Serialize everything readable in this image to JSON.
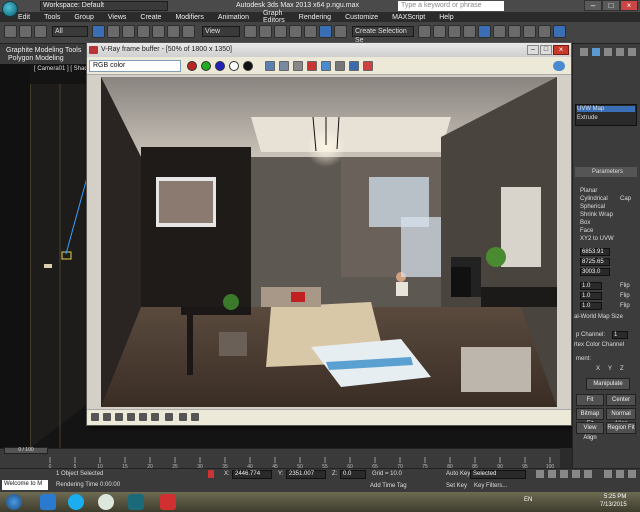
{
  "titlebar": {
    "workspace": "Workspace: Default",
    "window_title": "Autodesk 3ds Max  2013 x64     p.ngu.max",
    "search_placeholder": "Type a keyword or phrase"
  },
  "menu": [
    "Edit",
    "Tools",
    "Group",
    "Views",
    "Create",
    "Modifiers",
    "Animation",
    "Graph Editors",
    "Rendering",
    "Customize",
    "MAXScript",
    "Help"
  ],
  "toolbar": {
    "filter": "All",
    "ref_coord": "View",
    "selection_set": "Create Selection Se"
  },
  "graphite": {
    "title": "Graphite Modeling Tools",
    "subtitle": "Polygon Modeling"
  },
  "viewport": {
    "label": "[ Camera01 ] [ Shade"
  },
  "vfb": {
    "title": "V-Ray frame buffer - [50% of 1800 x 1350]",
    "channel": "RGB color"
  },
  "command_panel": {
    "modifier_list": [
      "UVW Map",
      "Extrude"
    ],
    "parameters_label": "Parameters",
    "mapping": [
      "Planar",
      "Cylindrical",
      "Cap",
      "Spherical",
      "Shrink Wrap",
      "Box",
      "Face",
      "XY2 to UVW"
    ],
    "length": "6853.91",
    "width": "8725.65",
    "height": "3003.0",
    "tile_u": "1.0",
    "tile_v": "1.0",
    "tile_w": "1.0",
    "flip": "Flip",
    "real_world": "al-World Map Size",
    "channel": "p Channel:",
    "channel_value": "1",
    "vertex_color": "rtex Color Channel",
    "alignment": "ment:",
    "axis": [
      "X",
      "Y",
      "Z"
    ],
    "manipulate": "Manipulate",
    "fit": "Fit",
    "center": "Center",
    "bitmap_fit": "Bitmap Fit",
    "normal_align": "Normal Align",
    "view_align": "View Align",
    "region_fit": "Region Fit"
  },
  "timeline": {
    "frame_slider": "0 / 100",
    "ticks": [
      "0",
      "5",
      "10",
      "15",
      "20",
      "25",
      "30",
      "35",
      "40",
      "45",
      "50",
      "55",
      "60",
      "65",
      "70",
      "75",
      "80",
      "85",
      "90",
      "95",
      "100"
    ]
  },
  "status": {
    "maxscript": "Welcome to M",
    "selected": "1 Object Selected",
    "render_time": "Rendering Time  0:00:00",
    "x_label": "X:",
    "x_value": "2446.774",
    "y_label": "Y:",
    "y_value": "2351.007",
    "z_label": "Z:",
    "z_value": "0.0",
    "grid": "Grid = 10.0",
    "add_time_tag": "Add Time Tag",
    "auto_key": "Auto Key",
    "selected_dropdown": "Selected",
    "set_key": "Set Key",
    "key_filters": "Key Filters..."
  },
  "taskbar": {
    "language": "EN",
    "time": "5:25 PM",
    "date": "7/13/2015"
  },
  "colors": {
    "accent_blue": "#3b6fb5",
    "vfb_bg": "#d4d0c8"
  }
}
